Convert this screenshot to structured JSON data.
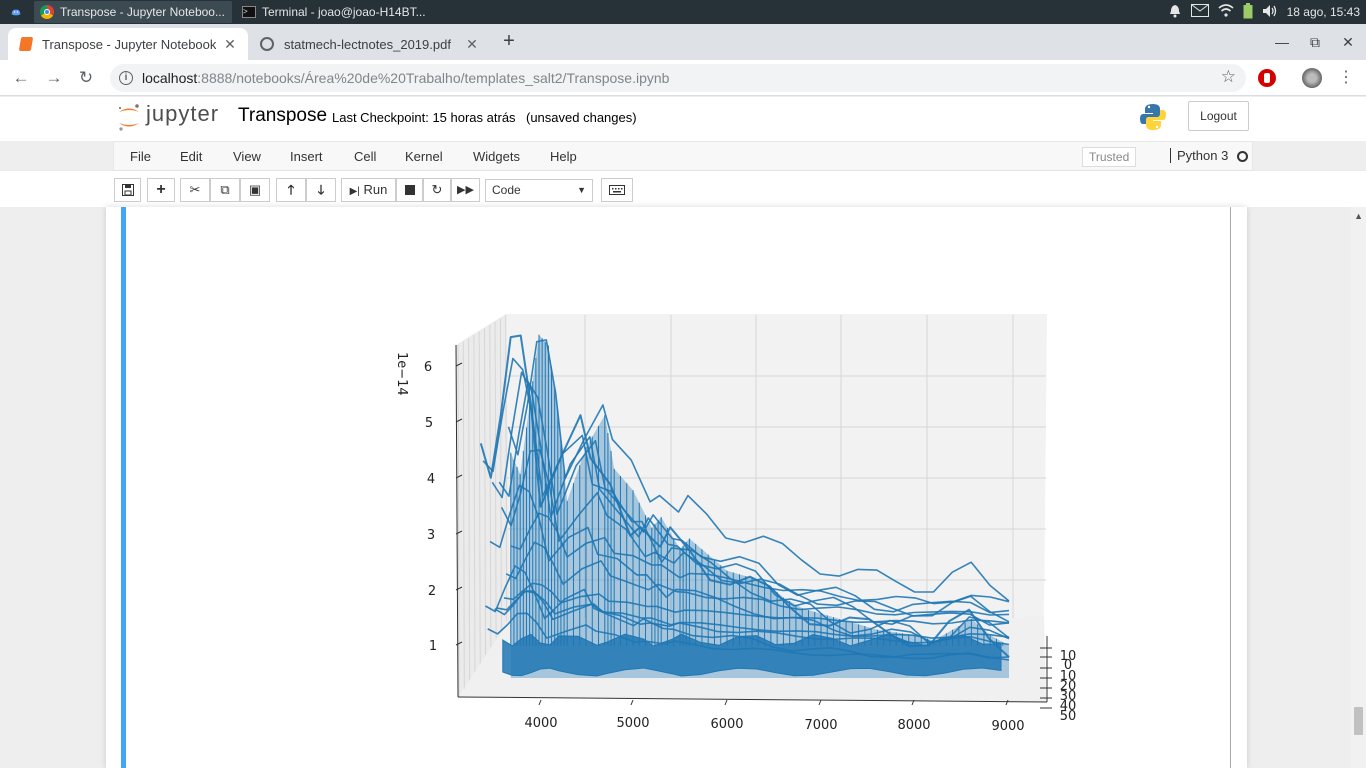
{
  "os": {
    "tasks": [
      {
        "label": "Transpose - Jupyter Noteboo...",
        "active": true
      },
      {
        "label": "Terminal - joao@joao-H14BT...",
        "active": false
      }
    ],
    "clock": "18 ago, 15:43"
  },
  "browser": {
    "tabs": [
      {
        "title": "Transpose - Jupyter Notebook",
        "active": true
      },
      {
        "title": "statmech-lectnotes_2019.pdf",
        "active": false
      }
    ],
    "url_host": "localhost",
    "url_rest": ":8888/notebooks/Área%20de%20Trabalho/templates_salt2/Transpose.ipynb"
  },
  "jupyter": {
    "logo_text": "jupyter",
    "notebook_name": "Transpose",
    "checkpoint": "Last Checkpoint: 15 horas atrás",
    "unsaved": "(unsaved changes)",
    "logout": "Logout",
    "menu": [
      "File",
      "Edit",
      "View",
      "Insert",
      "Cell",
      "Kernel",
      "Widgets",
      "Help"
    ],
    "trusted": "Trusted",
    "kernel": "Python 3",
    "toolbar": {
      "run_label": "Run",
      "cell_type": "Code"
    }
  },
  "chart_data": {
    "type": "surface3d",
    "z_offset_label": "1e−14",
    "x_ticks": [
      "4000",
      "5000",
      "6000",
      "7000",
      "8000",
      "9000"
    ],
    "y_ticks": [
      "10",
      "0",
      "10",
      "20",
      "30",
      "40",
      "50"
    ],
    "z_ticks": [
      "1",
      "2",
      "3",
      "4",
      "5",
      "6"
    ],
    "x_range": [
      3500,
      9000
    ],
    "y_range": [
      -10,
      50
    ],
    "z_range": [
      0,
      6.5
    ],
    "surface_color": "#1f77b4",
    "front_profile": {
      "x": [
        3700,
        3800,
        3900,
        4000,
        4100,
        4200,
        4300,
        4500,
        4700,
        4800,
        5000,
        5200,
        5300,
        5500,
        5600,
        5800,
        6000,
        6200,
        6400,
        6600,
        6800,
        7000,
        7200,
        7400,
        7600,
        7800,
        8000,
        8200,
        8400,
        8600,
        8800,
        9000
      ],
      "z": [
        4.2,
        3.8,
        5.1,
        6.4,
        6.2,
        5.0,
        3.3,
        4.3,
        4.9,
        3.9,
        3.5,
        2.8,
        3.0,
        2.4,
        2.6,
        2.3,
        2.0,
        1.9,
        1.8,
        1.5,
        1.3,
        1.2,
        1.1,
        1.0,
        0.9,
        0.85,
        0.8,
        0.7,
        0.9,
        1.1,
        0.8,
        0.6
      ]
    }
  }
}
